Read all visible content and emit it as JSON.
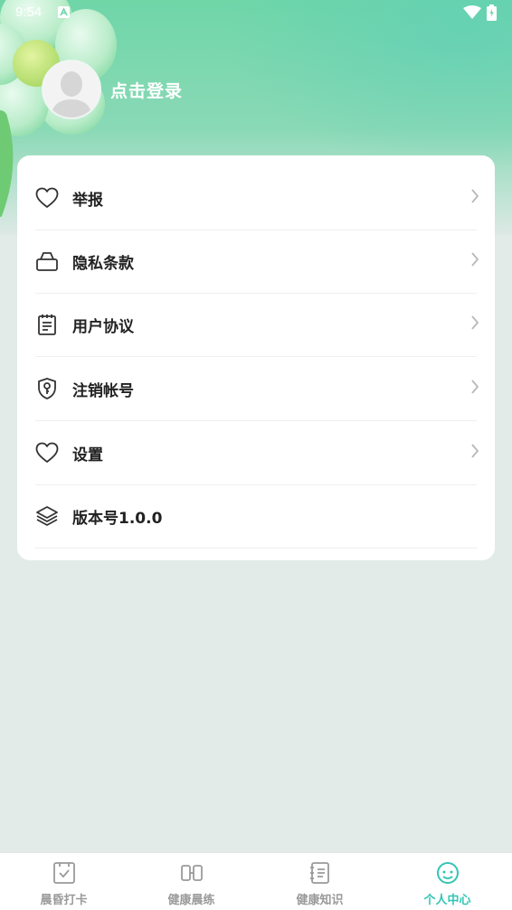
{
  "status_bar": {
    "time": "9:54"
  },
  "profile": {
    "login_label": "点击登录"
  },
  "menu": {
    "items": [
      {
        "label": "举报",
        "icon": "heart-icon"
      },
      {
        "label": "隐私条款",
        "icon": "lock-icon"
      },
      {
        "label": "用户协议",
        "icon": "clipboard-icon"
      },
      {
        "label": "注销帐号",
        "icon": "shield-key-icon"
      },
      {
        "label": "设置",
        "icon": "heart-icon"
      },
      {
        "label": "版本号1.0.0",
        "icon": "layers-icon"
      }
    ]
  },
  "tabbar": {
    "tabs": [
      {
        "label": "晨昏打卡",
        "icon": "checkin-icon",
        "active": false
      },
      {
        "label": "健康晨练",
        "icon": "exercise-icon",
        "active": false
      },
      {
        "label": "健康知识",
        "icon": "notebook-icon",
        "active": false
      },
      {
        "label": "个人中心",
        "icon": "smiley-icon",
        "active": true
      }
    ]
  },
  "colors": {
    "accent": "#32c6b4",
    "hero_green": "#6fd6a8",
    "background": "#e3ebe8"
  }
}
